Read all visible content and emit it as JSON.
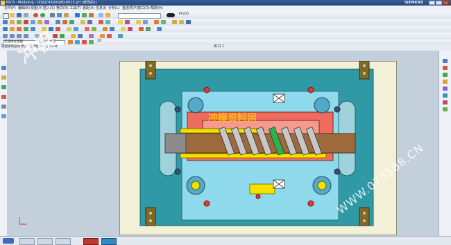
{
  "window": {
    "title": "NX 6 - Modeling - [KSQC4XXXG80-0015.prt (修改的)]",
    "brand": "SIEMENS"
  },
  "menu": [
    "文件(F)",
    "编辑(E)",
    "视图(V)",
    "插入(S)",
    "格式(R)",
    "工具(T)",
    "装配(A)",
    "信息(I)",
    "分析(L)",
    "首选项(P)",
    "窗口(O)",
    "帮助(H)"
  ],
  "toolbar": {
    "combo_value": "PF200",
    "filter_label": "无选择过滤器",
    "scope_label": "整个装配",
    "snap_label": "2D",
    "breadcrumb": "装配级别运动 原点: 建模视图 - 成形工件",
    "view_label": "视 口 1"
  },
  "watermark": {
    "left": "冲模",
    "center": "冲模资料网",
    "url": "WWW.075588.CN"
  },
  "colors": {
    "mold_base": "#2f9aa6",
    "plate": "#8fd9ec",
    "die_insert": "#ef6b5e",
    "strip": "#9d6a3e",
    "accent_yellow": "#f5e100",
    "clamp": "#7f6a2b",
    "sheet": "#f3f0d8"
  },
  "icons": [
    "new-icon",
    "open-icon",
    "save-icon",
    "print-icon",
    "undo-icon",
    "redo-icon",
    "cut-icon",
    "copy-icon",
    "paste-icon",
    "zoom-icon",
    "rotate-icon",
    "fit-icon",
    "shade-icon",
    "layer-icon"
  ]
}
